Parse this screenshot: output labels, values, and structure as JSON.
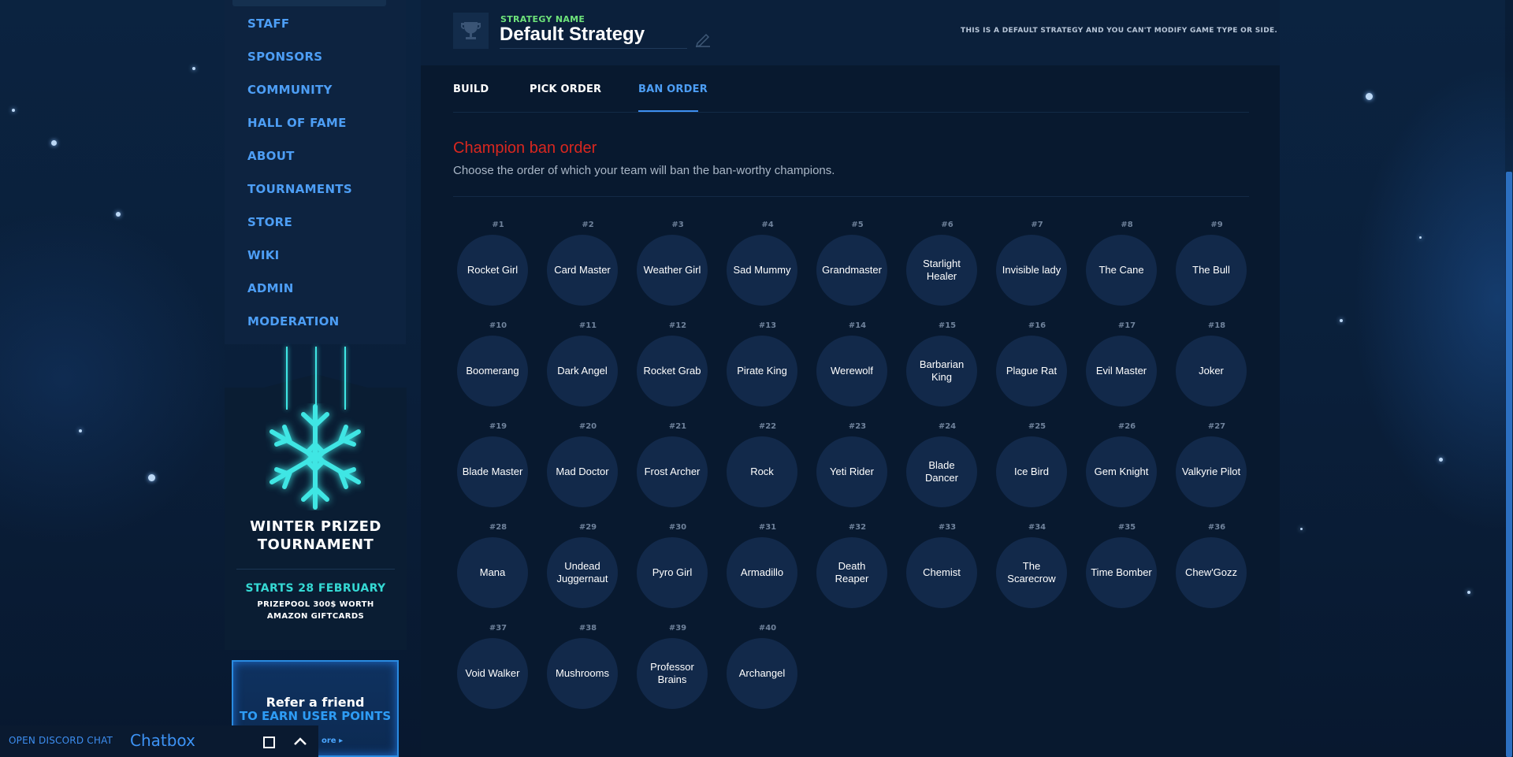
{
  "nav": {
    "items": [
      {
        "label": "STAFF"
      },
      {
        "label": "SPONSORS"
      },
      {
        "label": "COMMUNITY"
      },
      {
        "label": "HALL OF FAME"
      },
      {
        "label": "ABOUT"
      },
      {
        "label": "TOURNAMENTS"
      },
      {
        "label": "STORE"
      },
      {
        "label": "WIKI"
      },
      {
        "label": "ADMIN"
      },
      {
        "label": "MODERATION"
      }
    ]
  },
  "promo": {
    "title_line1": "WINTER PRIZED",
    "title_line2": "TOURNAMENT",
    "starts": "STARTS 28 FEBRUARY",
    "prize_line1": "PRIZEPOOL 300$ WORTH",
    "prize_line2": "AMAZON GIFTCARDS",
    "accent_color": "#3fe6e4"
  },
  "refer": {
    "line1": "Refer a friend",
    "line2": "TO EARN USER POINTS",
    "more": "ore"
  },
  "chat": {
    "discord": "OPEN DISCORD CHAT",
    "title": "Chatbox"
  },
  "strategy": {
    "label": "STRATEGY NAME",
    "name": "Default Strategy",
    "note": "THIS IS A DEFAULT STRATEGY AND YOU CAN'T MODIFY GAME TYPE OR SIDE."
  },
  "tabs": [
    {
      "label": "BUILD"
    },
    {
      "label": "PICK ORDER"
    },
    {
      "label": "BAN ORDER"
    }
  ],
  "section": {
    "title": "Champion ban order",
    "subtitle": "Choose the order of which your team will ban the ban-worthy champions."
  },
  "champions": [
    {
      "rank": "#1",
      "name": "Rocket Girl"
    },
    {
      "rank": "#2",
      "name": "Card Master"
    },
    {
      "rank": "#3",
      "name": "Weather Girl"
    },
    {
      "rank": "#4",
      "name": "Sad Mummy"
    },
    {
      "rank": "#5",
      "name": "Grandmaster"
    },
    {
      "rank": "#6",
      "name": "Starlight Healer"
    },
    {
      "rank": "#7",
      "name": "Invisible lady"
    },
    {
      "rank": "#8",
      "name": "The Cane"
    },
    {
      "rank": "#9",
      "name": "The Bull"
    },
    {
      "rank": "#10",
      "name": "Boomerang"
    },
    {
      "rank": "#11",
      "name": "Dark Angel"
    },
    {
      "rank": "#12",
      "name": "Rocket Grab"
    },
    {
      "rank": "#13",
      "name": "Pirate King"
    },
    {
      "rank": "#14",
      "name": "Werewolf"
    },
    {
      "rank": "#15",
      "name": "Barbarian King"
    },
    {
      "rank": "#16",
      "name": "Plague Rat"
    },
    {
      "rank": "#17",
      "name": "Evil Master"
    },
    {
      "rank": "#18",
      "name": "Joker"
    },
    {
      "rank": "#19",
      "name": "Blade Master"
    },
    {
      "rank": "#20",
      "name": "Mad Doctor"
    },
    {
      "rank": "#21",
      "name": "Frost Archer"
    },
    {
      "rank": "#22",
      "name": "Rock"
    },
    {
      "rank": "#23",
      "name": "Yeti Rider"
    },
    {
      "rank": "#24",
      "name": "Blade Dancer"
    },
    {
      "rank": "#25",
      "name": "Ice Bird"
    },
    {
      "rank": "#26",
      "name": "Gem Knight"
    },
    {
      "rank": "#27",
      "name": "Valkyrie Pilot"
    },
    {
      "rank": "#28",
      "name": "Mana"
    },
    {
      "rank": "#29",
      "name": "Undead Juggernaut"
    },
    {
      "rank": "#30",
      "name": "Pyro Girl"
    },
    {
      "rank": "#31",
      "name": "Armadillo"
    },
    {
      "rank": "#32",
      "name": "Death Reaper"
    },
    {
      "rank": "#33",
      "name": "Chemist"
    },
    {
      "rank": "#34",
      "name": "The Scarecrow"
    },
    {
      "rank": "#35",
      "name": "Time Bomber"
    },
    {
      "rank": "#36",
      "name": "Chew'Gozz"
    },
    {
      "rank": "#37",
      "name": "Void Walker"
    },
    {
      "rank": "#38",
      "name": "Mushrooms"
    },
    {
      "rank": "#39",
      "name": "Professor Brains"
    },
    {
      "rank": "#40",
      "name": "Archangel"
    }
  ]
}
